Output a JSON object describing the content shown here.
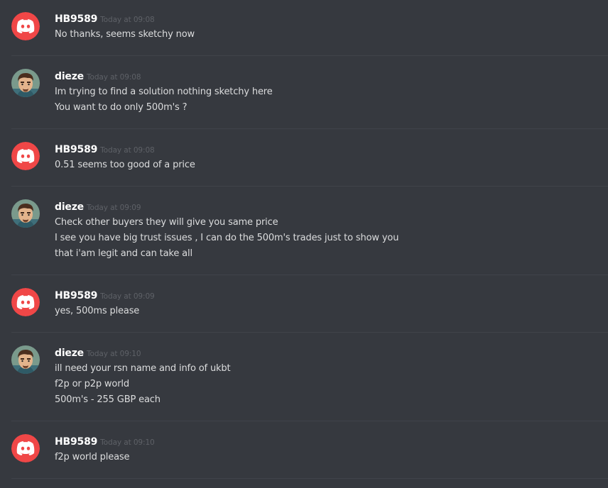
{
  "colors": {
    "background": "#36393f",
    "discord_red": "#f04747",
    "username": "#ffffff",
    "timestamp": "#5e6167",
    "message_text": "#dcddde"
  },
  "messages": [
    {
      "author": "HB9589",
      "avatar_icon": "discord-logo-icon",
      "timestamp": "Today at 09:08",
      "lines": [
        "No thanks, seems sketchy now"
      ]
    },
    {
      "author": "dieze",
      "avatar_icon": "user-avatar-face",
      "timestamp": "Today at 09:08",
      "lines": [
        "Im trying to find a solution nothing sketchy here",
        "You want to do only 500m's ?"
      ]
    },
    {
      "author": "HB9589",
      "avatar_icon": "discord-logo-icon",
      "timestamp": "Today at 09:08",
      "lines": [
        "0.51 seems too good of a price"
      ]
    },
    {
      "author": "dieze",
      "avatar_icon": "user-avatar-face",
      "timestamp": "Today at 09:09",
      "lines": [
        "Check other buyers they will give you same price",
        "I see you have big trust issues , I can do the 500m's trades just to show you",
        "that i'am legit and can take all"
      ]
    },
    {
      "author": "HB9589",
      "avatar_icon": "discord-logo-icon",
      "timestamp": "Today at 09:09",
      "lines": [
        "yes, 500ms please"
      ]
    },
    {
      "author": "dieze",
      "avatar_icon": "user-avatar-face",
      "timestamp": "Today at 09:10",
      "lines": [
        "ill need your rsn name and info of ukbt",
        "f2p or p2p world",
        "500m's - 255 GBP each"
      ]
    },
    {
      "author": "HB9589",
      "avatar_icon": "discord-logo-icon",
      "timestamp": "Today at 09:10",
      "lines": [
        "f2p world please"
      ]
    }
  ]
}
